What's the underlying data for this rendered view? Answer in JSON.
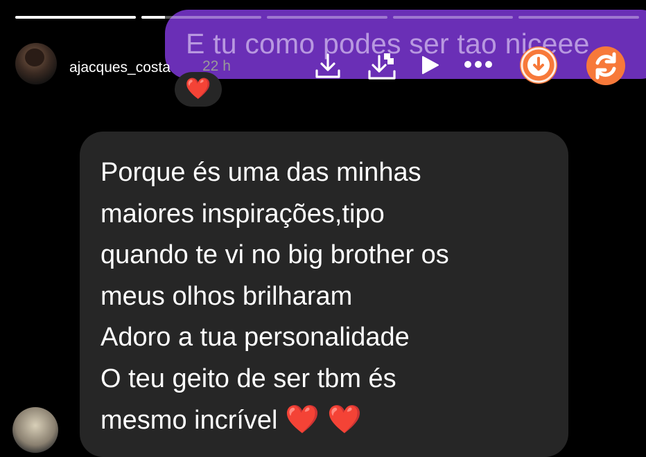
{
  "story": {
    "segments": [
      1,
      0.2,
      0,
      0,
      0
    ]
  },
  "sent_message": {
    "text": "E tu como podes ser tao niceee"
  },
  "header": {
    "username": "ajacques_costa",
    "time": "22 h"
  },
  "toolbar": {
    "icons": [
      "download-icon",
      "download-all-icon",
      "play-icon",
      "more-icon",
      "download-circle-icon",
      "sync-icon"
    ],
    "accent_orange": "#f7793a"
  },
  "reaction": {
    "emoji": "❤️"
  },
  "message": {
    "lines": [
      "Porque és uma das minhas",
      "maiores inspirações,tipo",
      "quando te vi no big brother os",
      "meus olhos brilharam",
      "Adoro a tua personalidade",
      "O teu geito de ser tbm és",
      "mesmo incrível"
    ],
    "trailing_emoji": "❤️ ❤️"
  }
}
